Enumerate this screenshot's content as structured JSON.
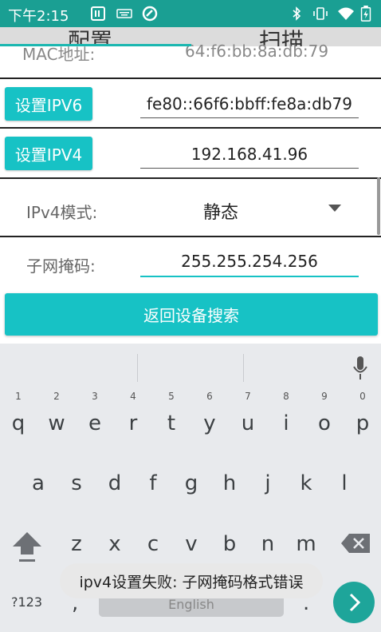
{
  "status": {
    "time": "下午2:15"
  },
  "tabs": [
    {
      "label": "配置"
    },
    {
      "label": "扫描"
    }
  ],
  "mac": {
    "label": "MAC地址:",
    "value": "64:f6:bb:8a:db:79"
  },
  "ipv6": {
    "button": "设置IPV6",
    "value": "fe80::66f6:bbff:fe8a:db79"
  },
  "ipv4": {
    "button": "设置IPV4",
    "value": "192.168.41.96"
  },
  "mode": {
    "label": "IPv4模式:",
    "value": "静态"
  },
  "subnet": {
    "label": "子网掩码:",
    "value": "255.255.254.256"
  },
  "return_button": "返回设备搜索",
  "keyboard": {
    "row1": [
      {
        "ch": "q",
        "hint": "1"
      },
      {
        "ch": "w",
        "hint": "2"
      },
      {
        "ch": "e",
        "hint": "3"
      },
      {
        "ch": "r",
        "hint": "4"
      },
      {
        "ch": "t",
        "hint": "5"
      },
      {
        "ch": "y",
        "hint": "6"
      },
      {
        "ch": "u",
        "hint": "7"
      },
      {
        "ch": "i",
        "hint": "8"
      },
      {
        "ch": "o",
        "hint": "9"
      },
      {
        "ch": "p",
        "hint": "0"
      }
    ],
    "row2": [
      "a",
      "s",
      "d",
      "f",
      "g",
      "h",
      "j",
      "k",
      "l"
    ],
    "row3": [
      "z",
      "x",
      "c",
      "v",
      "b",
      "n",
      "m"
    ],
    "symbols": "?123",
    "comma": ",",
    "space": "English",
    "period": "."
  },
  "toast": "ipv4设置失败: 子网掩码格式错误",
  "colors": {
    "accent": "#17c2c5",
    "status_bar": "#1a9f93",
    "keyboard_bg": "#e8eaed"
  }
}
